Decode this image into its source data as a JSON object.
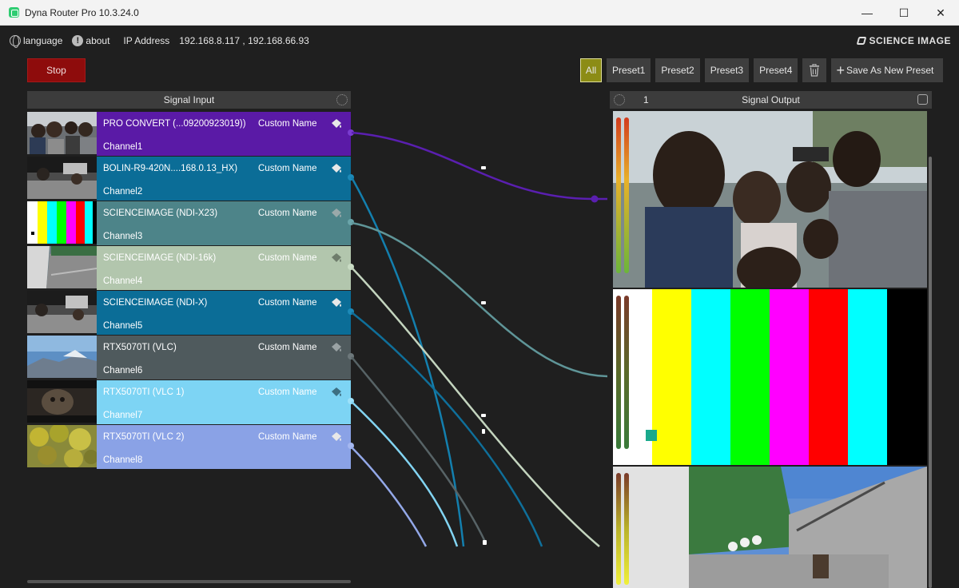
{
  "window": {
    "title": "Dyna Router Pro 10.3.24.0",
    "minimize": "—",
    "maximize": "☐",
    "close": "✕"
  },
  "infobar": {
    "language": "language",
    "about": "about",
    "ip_label": "IP Address",
    "ip_value": "192.168.8.117 , 192.168.66.93",
    "brand": "SCIENCE IMAGE"
  },
  "stop_label": "Stop",
  "presets": {
    "all": "All",
    "items": [
      "Preset1",
      "Preset2",
      "Preset3",
      "Preset4"
    ],
    "save": "Save As New Preset"
  },
  "signal_input": {
    "title": "Signal Input",
    "custom_label": "Custom Name",
    "channels": [
      {
        "source": "PRO CONVERT (...09200923019))",
        "name": "Channel1",
        "color": "#5a1aa6",
        "text_color": "#ffffff",
        "dot": "#7a3cd0"
      },
      {
        "source": "BOLIN-R9-420N....168.0.13_HX)",
        "name": "Channel2",
        "color": "#0b6d97",
        "text_color": "#ffffff",
        "dot": "#1d8ab8"
      },
      {
        "source": "SCIENCEIMAGE (NDI-X23)",
        "name": "Channel3",
        "color": "#4d8489",
        "text_color": "#ffffff",
        "dot": "#6aa5aa"
      },
      {
        "source": "SCIENCEIMAGE (NDI-16k)",
        "name": "Channel4",
        "color": "#b2c6ad",
        "text_color": "#ffffff",
        "dot": "#c9dcc4"
      },
      {
        "source": "SCIENCEIMAGE (NDI-X)",
        "name": "Channel5",
        "color": "#0b6d97",
        "text_color": "#ffffff",
        "dot": "#1d8ab8"
      },
      {
        "source": "RTX5070TI (VLC)",
        "name": "Channel6",
        "color": "#4f5a5d",
        "text_color": "#ffffff",
        "dot": "#6d787b"
      },
      {
        "source": "RTX5070TI (VLC 1)",
        "name": "Channel7",
        "color": "#7dd4f4",
        "text_color": "#ffffff",
        "dot": "#9ee2fa"
      },
      {
        "source": "RTX5070TI (VLC 2)",
        "name": "Channel8",
        "color": "#8aa2e6",
        "text_color": "#ffffff",
        "dot": "#a5b8f0"
      }
    ]
  },
  "signal_output": {
    "title": "Signal Output",
    "number": "1"
  }
}
